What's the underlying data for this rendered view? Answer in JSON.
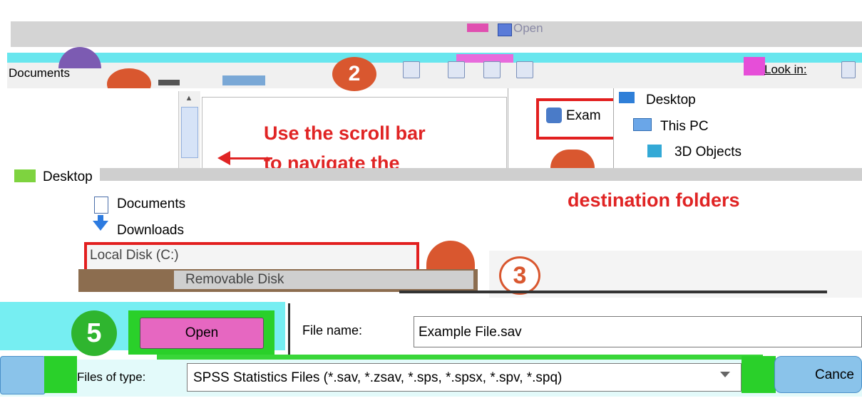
{
  "window": {
    "title": "Open"
  },
  "toolbar": {
    "location": "Documents",
    "look_in_label": "Look in:",
    "badge_2": "2"
  },
  "annotations": {
    "scroll_line1": "Use the scroll bar",
    "scroll_line2": "to navigate the",
    "destination": "destination folders"
  },
  "file_list": {
    "example_item": "Exam"
  },
  "folder_tree": {
    "items": [
      "Desktop",
      "This PC",
      "3D Objects"
    ]
  },
  "lower_tree": {
    "desktop": "Desktop",
    "documents": "Documents",
    "downloads": "Downloads",
    "local_disk": "Local Disk (C:)",
    "removable": "Removable Disk"
  },
  "badges": {
    "step5": "5",
    "step3": "3"
  },
  "form": {
    "open_button": "Open",
    "file_name_label": "File name:",
    "file_name_value": "Example File.sav",
    "files_of_type_label": "Files of type:",
    "files_of_type_value": "SPSS Statistics Files (*.sav, *.zsav, *.sps, *.spsx, *.spv, *.spq)",
    "cancel_button": "Cance"
  },
  "colors": {
    "annotation_red": "#e02424",
    "highlight_green": "#2ad02a",
    "step_badge_orange": "#d9572f"
  }
}
